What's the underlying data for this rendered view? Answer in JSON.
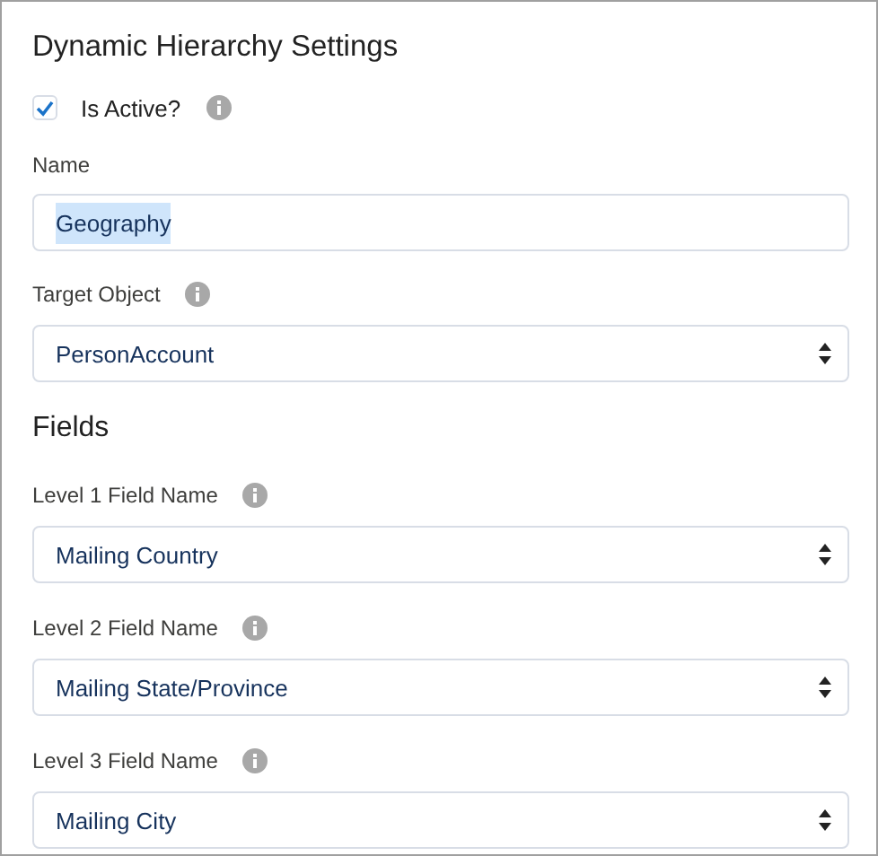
{
  "title": "Dynamic Hierarchy Settings",
  "is_active": {
    "label": "Is Active?",
    "checked": true
  },
  "name_field": {
    "label": "Name",
    "value": "Geography",
    "highlighted": true
  },
  "target_object": {
    "label": "Target Object",
    "value": "PersonAccount"
  },
  "fields_heading": "Fields",
  "levels": [
    {
      "label": "Level 1 Field Name",
      "value": "Mailing Country"
    },
    {
      "label": "Level 2 Field Name",
      "value": "Mailing State/Province"
    },
    {
      "label": "Level 3 Field Name",
      "value": "Mailing City"
    }
  ]
}
